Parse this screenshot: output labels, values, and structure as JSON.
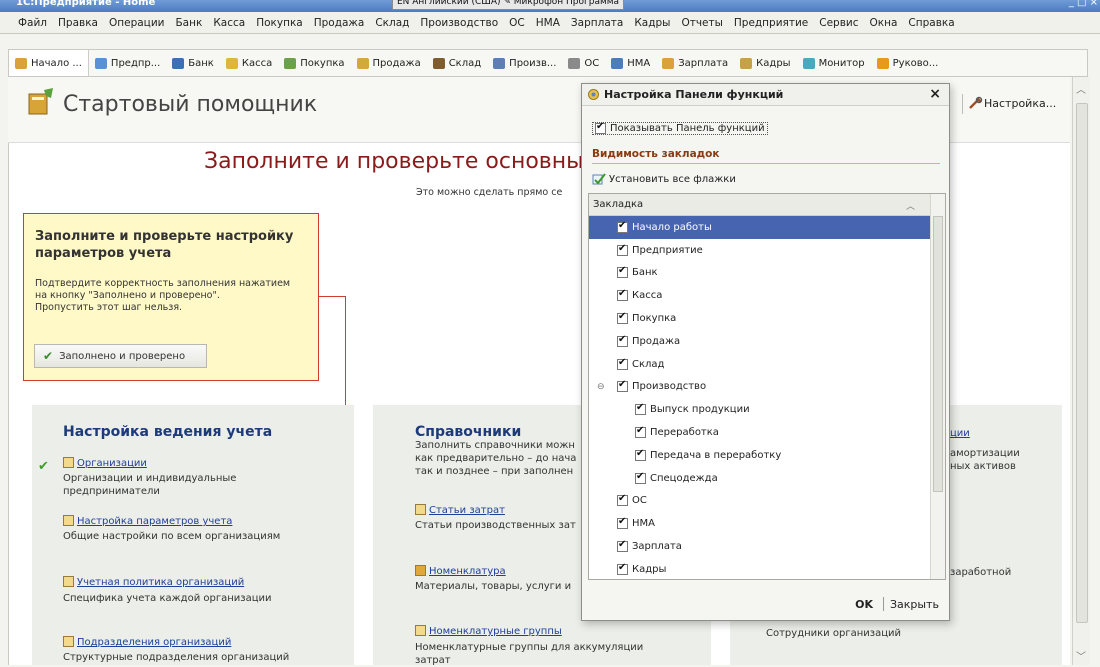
{
  "window": {
    "app_title": "1С:Предприятие - Home",
    "tray": "EN Английский (США)  ✎ Микрофон  Программа",
    "controls": "_ □ ×"
  },
  "menu": [
    "Файл",
    "Правка",
    "Операции",
    "Банк",
    "Касса",
    "Покупка",
    "Продажа",
    "Склад",
    "Производство",
    "ОС",
    "НМА",
    "Зарплата",
    "Кадры",
    "Отчеты",
    "Предприятие",
    "Сервис",
    "Окна",
    "Справка"
  ],
  "tabs": [
    {
      "label": "Начало ...",
      "color": "#d9a23a"
    },
    {
      "label": "Предпр...",
      "color": "#5b8fd6"
    },
    {
      "label": "Банк",
      "color": "#3d6fb5"
    },
    {
      "label": "Касса",
      "color": "#e0b53c"
    },
    {
      "label": "Покупка",
      "color": "#6ba14a"
    },
    {
      "label": "Продажа",
      "color": "#d2a93a"
    },
    {
      "label": "Склад",
      "color": "#7f5b2e"
    },
    {
      "label": "Произв...",
      "color": "#5a7fb0"
    },
    {
      "label": "ОС",
      "color": "#8a8a8a"
    },
    {
      "label": "НМА",
      "color": "#4a7dbd"
    },
    {
      "label": "Зарплата",
      "color": "#d9a23a"
    },
    {
      "label": "Кадры",
      "color": "#c7a04a"
    },
    {
      "label": "Монитор",
      "color": "#4aa8c0"
    },
    {
      "label": "Руково...",
      "color": "#e59a1a"
    }
  ],
  "page": {
    "title": "Стартовый помощник",
    "settings": "Настройка...",
    "headline": "Заполните и проверьте основные",
    "subline": "Это можно сделать прямо се"
  },
  "callout": {
    "title": "Заполните и проверьте настройку параметров учета",
    "text1": "Подтвердите корректность заполнения нажатием",
    "text2": "на кнопку \"Заполнено и проверено\".",
    "text3": "Пропустить этот шаг нельзя.",
    "button": "Заполнено и проверено"
  },
  "section1": {
    "title": "Настройка ведения учета",
    "items": [
      {
        "link": "Организации",
        "desc1": "Организации и индивидуальные",
        "desc2": "предприниматели"
      },
      {
        "link": "Настройка параметров учета",
        "desc1": "Общие настройки по всем организациям"
      },
      {
        "link": "Учетная политика организаций",
        "desc1": "Специфика учета каждой организации"
      },
      {
        "link": "Подразделения организаций",
        "desc1": "Структурные подразделения организаций"
      }
    ]
  },
  "section2": {
    "title": "Справочники",
    "intro1": "Заполнить справочники можн",
    "intro2": "как предварительно – до нача",
    "intro3": "так и позднее – при заполнен",
    "items": [
      {
        "link": "Статьи затрат",
        "desc1": "Статьи производственных зат"
      },
      {
        "link": "Номенклатура",
        "desc1": "Материалы, товары, услуги и"
      },
      {
        "link": "Номенклатурные группы",
        "desc1": "Номенклатурные группы для аккумуляции",
        "desc2": "затрат"
      }
    ]
  },
  "section3": {
    "frag1": "ции",
    "frag2": "амортизации",
    "frag3": "ных активов",
    "frag4": "заработной",
    "frag5": "Сотрудники организаций"
  },
  "dialog": {
    "title": "Настройка Панели функций",
    "close": "×",
    "show_panel": "Показывать Панель функций",
    "visibility_label": "Видимость закладок",
    "set_all": "Установить все флажки",
    "column": "Закладка",
    "rows": [
      {
        "label": "Начало работы",
        "checked": true,
        "level": 0,
        "selected": true
      },
      {
        "label": "Предприятие",
        "checked": true,
        "level": 0
      },
      {
        "label": "Банк",
        "checked": true,
        "level": 0
      },
      {
        "label": "Касса",
        "checked": true,
        "level": 0
      },
      {
        "label": "Покупка",
        "checked": true,
        "level": 0
      },
      {
        "label": "Продажа",
        "checked": true,
        "level": 0
      },
      {
        "label": "Склад",
        "checked": true,
        "level": 0
      },
      {
        "label": "Производство",
        "checked": true,
        "level": 0,
        "expander": "⊖"
      },
      {
        "label": "Выпуск продукции",
        "checked": true,
        "level": 1
      },
      {
        "label": "Переработка",
        "checked": true,
        "level": 1
      },
      {
        "label": "Передача в переработку",
        "checked": true,
        "level": 1
      },
      {
        "label": "Спецодежда",
        "checked": true,
        "level": 1
      },
      {
        "label": "ОС",
        "checked": true,
        "level": 0
      },
      {
        "label": "НМА",
        "checked": true,
        "level": 0
      },
      {
        "label": "Зарплата",
        "checked": true,
        "level": 0
      },
      {
        "label": "Кадры",
        "checked": true,
        "level": 0
      }
    ],
    "ok": "OK",
    "close_button": "Закрыть"
  }
}
